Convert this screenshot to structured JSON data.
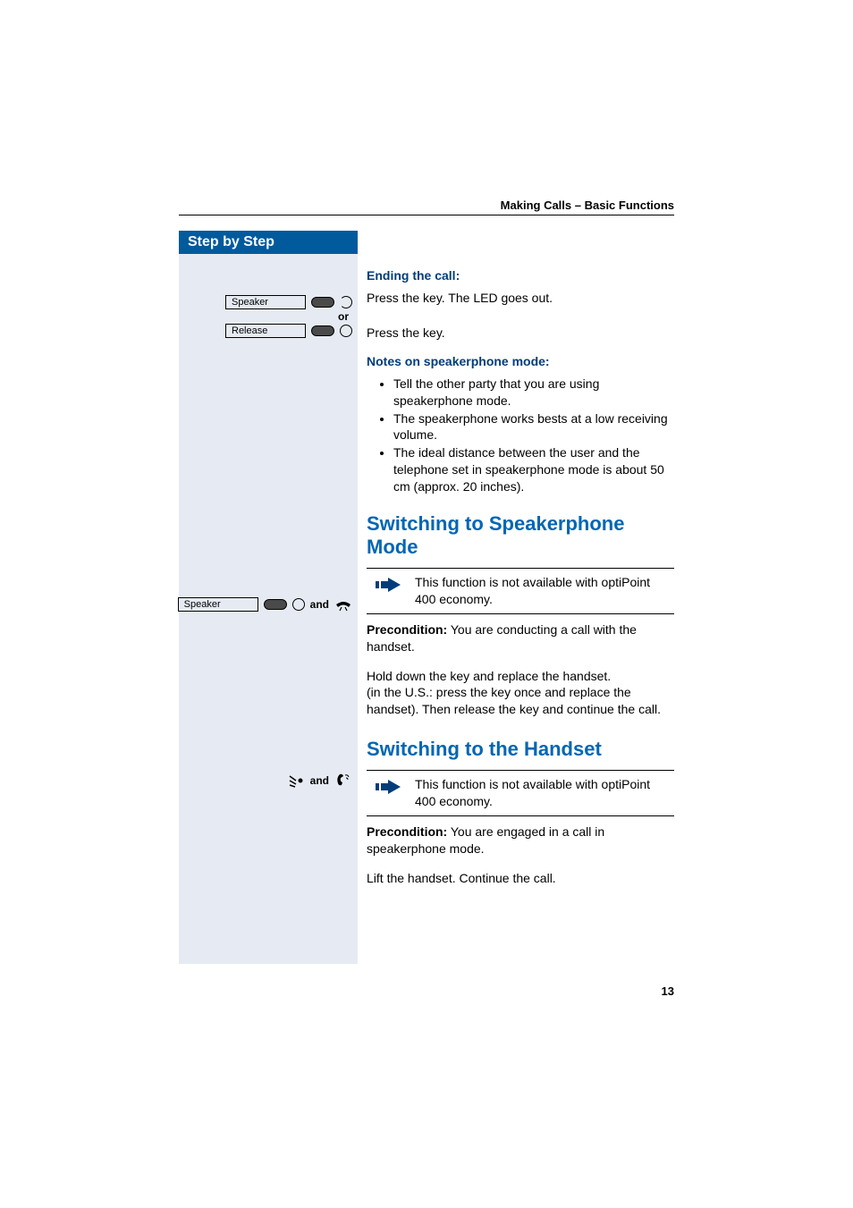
{
  "header": "Making Calls – Basic Functions",
  "sidebar": {
    "title": "Step by Step",
    "key_speaker1": "Speaker",
    "or_label": "or",
    "key_release": "Release",
    "key_speaker2": "Speaker",
    "and_label1": "and",
    "and_label2": "and"
  },
  "content": {
    "ending_title": "Ending the call:",
    "ending_text1": "Press the key. The LED goes out.",
    "ending_text2": "Press the key.",
    "notes_title": "Notes on speakerphone mode:",
    "notes": [
      "Tell the other party that you are using speakerphone mode.",
      "The speakerphone works bests at a low receiving volume.",
      "The ideal distance between the user and the telephone set in speakerphone mode is about 50 cm (approx. 20 inches)."
    ],
    "section1_title": "Switching to Speakerphone Mode",
    "info1": "This function is not available with optiPoint 400 economy.",
    "precond1_label": "Precondition:",
    "precond1_text": " You are conducting a call with the handset.",
    "section1_body": "Hold down the key and replace the handset.\n(in the U.S.: press the key once and replace the handset). Then release the key and continue the call.",
    "section2_title": "Switching to the Handset",
    "info2": "This function is not available with optiPoint 400 economy.",
    "precond2_label": "Precondition:",
    "precond2_text": " You are engaged in a call in speakerphone mode.",
    "section2_body": "Lift the handset. Continue the call."
  },
  "page_number": "13"
}
